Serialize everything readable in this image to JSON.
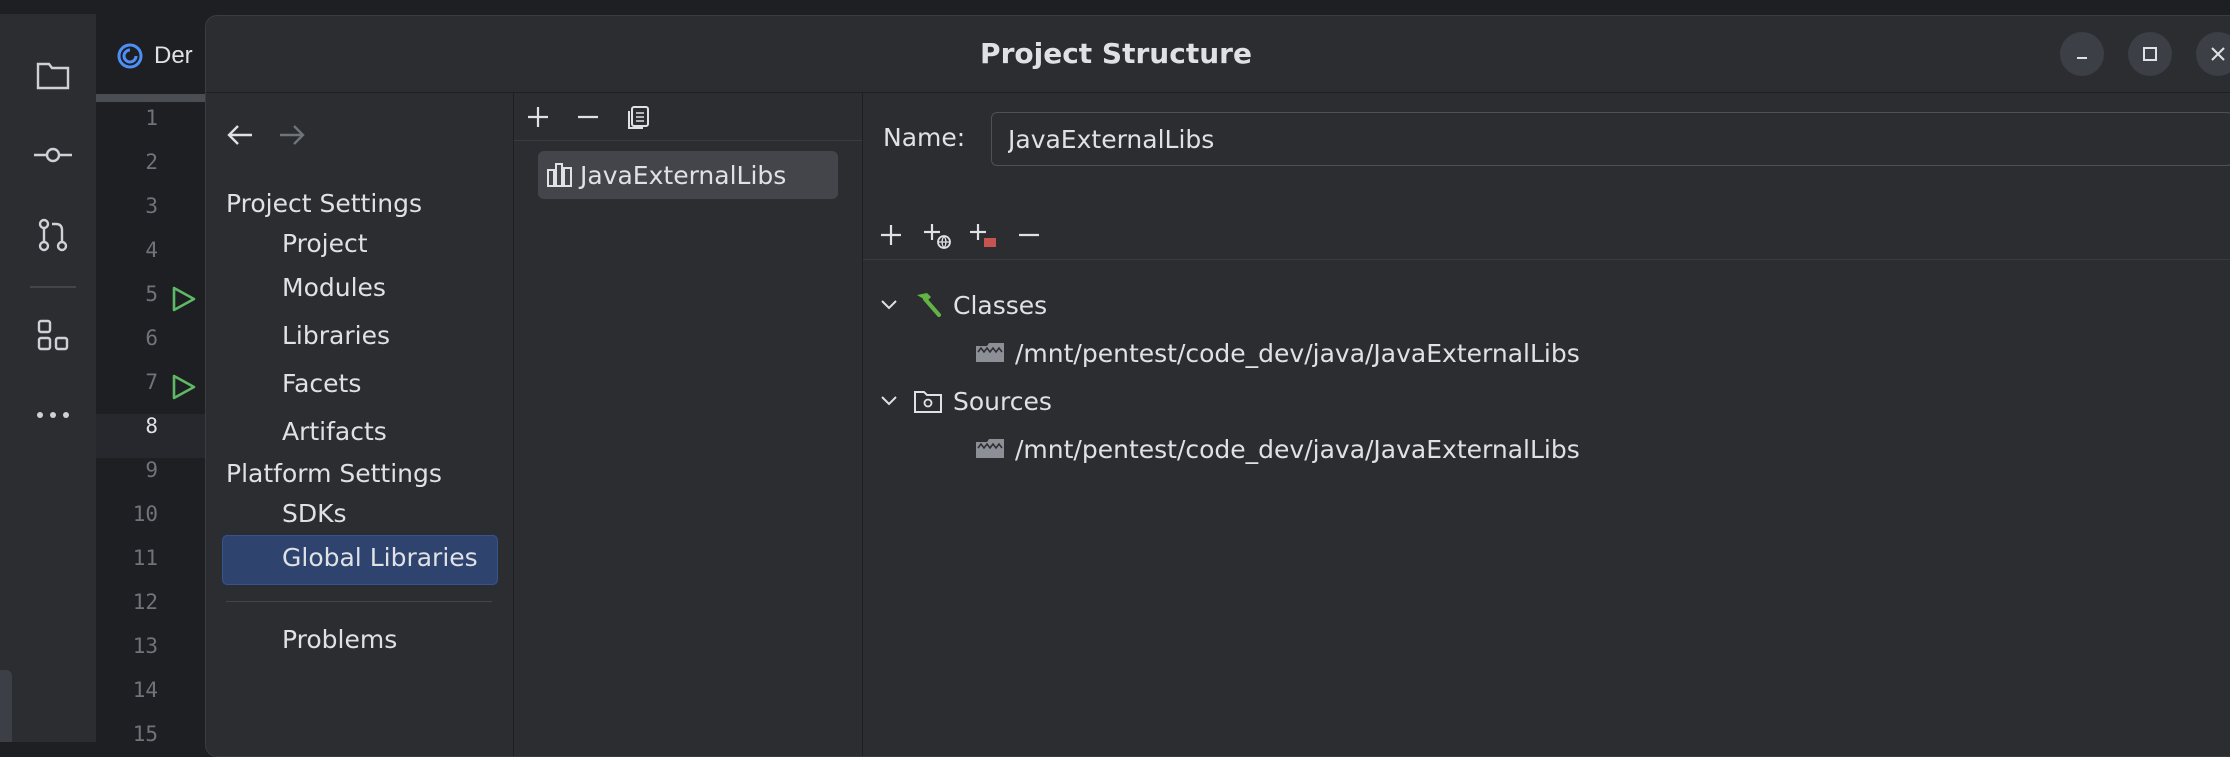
{
  "dialog": {
    "title": "Project Structure"
  },
  "background_ide": {
    "tab_label": "Der",
    "line_numbers": [
      "1",
      "2",
      "3",
      "4",
      "5",
      "6",
      "7",
      "8",
      "9",
      "10",
      "11",
      "12",
      "13",
      "14",
      "15"
    ],
    "current_line": "8"
  },
  "nav": {
    "sections": [
      {
        "title": "Project Settings",
        "items": [
          "Project",
          "Modules",
          "Libraries",
          "Facets",
          "Artifacts"
        ]
      },
      {
        "title": "Platform Settings",
        "items": [
          "SDKs",
          "Global Libraries"
        ]
      }
    ],
    "selected": "Global Libraries",
    "bottom_items": [
      "Problems"
    ]
  },
  "library_list": {
    "items": [
      "JavaExternalLibs"
    ],
    "selected": "JavaExternalLibs"
  },
  "detail": {
    "name_label": "Name:",
    "name_value": "JavaExternalLibs",
    "tree": [
      {
        "label": "Classes",
        "icon": "hammer-icon",
        "children": [
          "/mnt/pentest/code_dev/java/JavaExternalLibs"
        ]
      },
      {
        "label": "Sources",
        "icon": "source-folder-icon",
        "children": [
          "/mnt/pentest/code_dev/java/JavaExternalLibs"
        ]
      }
    ]
  },
  "colors": {
    "accent_selection": "#2e436e",
    "run_green": "#5fb865",
    "hammer_green": "#62b543"
  }
}
